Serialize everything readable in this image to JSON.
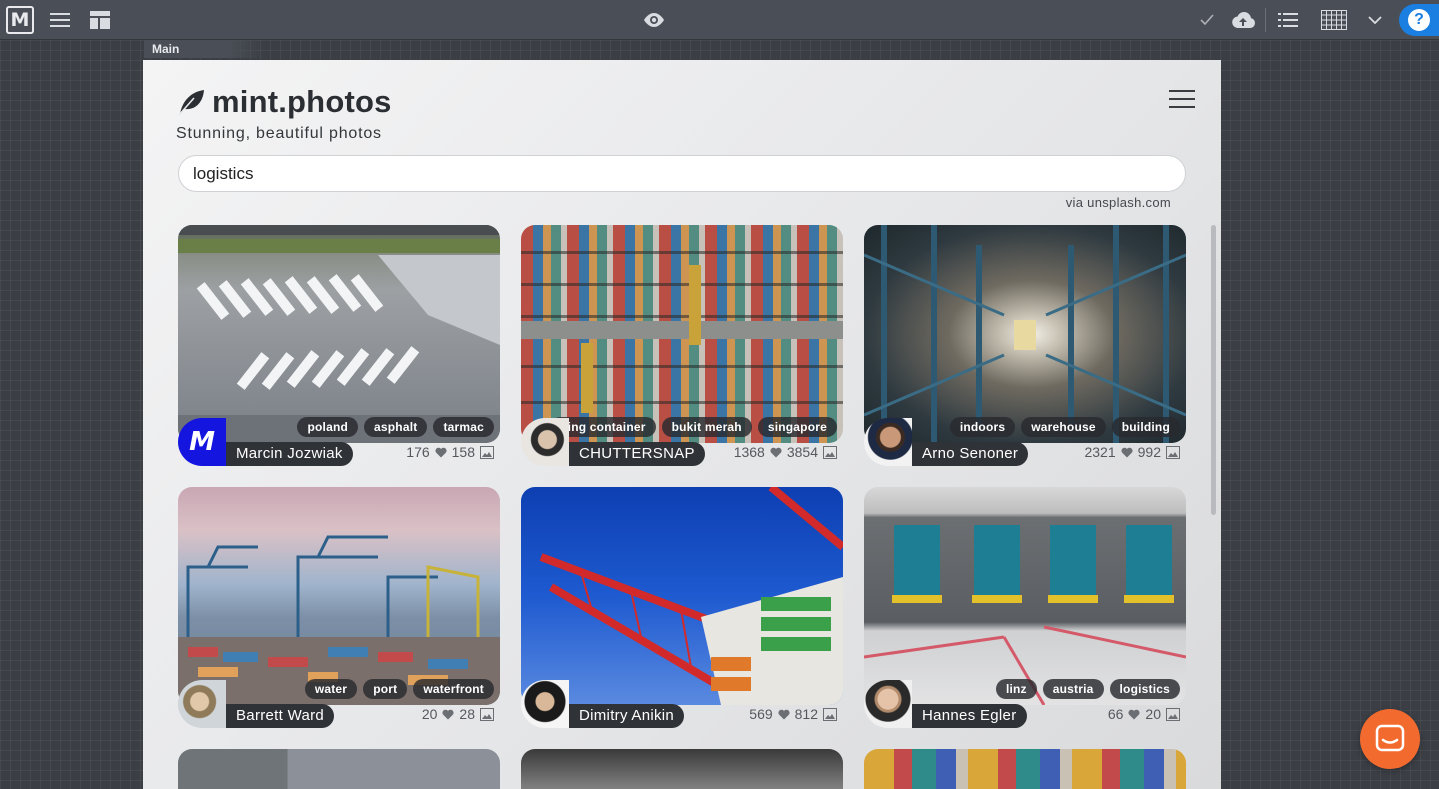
{
  "toolbar": {
    "logo_letter": "M",
    "tab_label": "Main"
  },
  "app": {
    "title": "mint.photos",
    "tagline": "Stunning, beautiful photos",
    "search_value": "logistics",
    "via": "via unsplash.com"
  },
  "photos": [
    {
      "author": "Marcin Jozwiak",
      "tags": [
        "poland",
        "asphalt",
        "tarmac"
      ],
      "likes": "176",
      "count": "158"
    },
    {
      "author": "CHUTTERSNAP",
      "tags": [
        "ping container",
        "bukit merah",
        "singapore"
      ],
      "likes": "1368",
      "count": "3854"
    },
    {
      "author": "Arno Senoner",
      "tags": [
        "indoors",
        "warehouse",
        "building"
      ],
      "likes": "2321",
      "count": "992"
    },
    {
      "author": "Barrett Ward",
      "tags": [
        "water",
        "port",
        "waterfront"
      ],
      "likes": "20",
      "count": "28"
    },
    {
      "author": "Dimitry Anikin",
      "tags": [],
      "likes": "569",
      "count": "812"
    },
    {
      "author": "Hannes Egler",
      "tags": [
        "linz",
        "austria",
        "logistics"
      ],
      "likes": "66",
      "count": "20"
    }
  ],
  "colors": {
    "toolbar_bg": "#4a4f57",
    "help_blue": "#1a7fe0",
    "chat_orange": "#f26a2e",
    "tag_bg": "#282a2e"
  }
}
